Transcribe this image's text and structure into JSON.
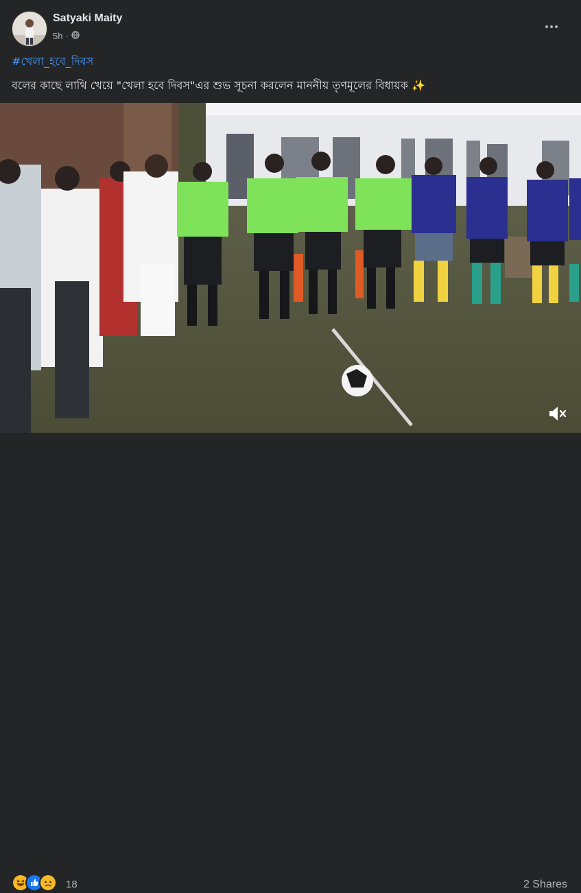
{
  "post": {
    "author": "Satyaki Maity",
    "time": "5h",
    "separator": "·",
    "audience_icon": "globe-icon",
    "hashtag": "#খেলা_হবে_দিবস",
    "caption": "বলের কাছে লাথি খেয়ে \"খেলা হবে দিবস\"এর শুভ সূচনা করলেন মাননীয় তৃণমূলের বিধায়ক",
    "caption_emoji": "✨"
  },
  "video": {
    "sound_icon": "speaker-muted-icon"
  },
  "footer": {
    "reaction_icons": [
      "haha-icon",
      "like-icon",
      "sad-icon"
    ],
    "reaction_count": "18",
    "shares": "2 Shares"
  },
  "colors": {
    "background": "#242526",
    "link": "#4599ff",
    "text_primary": "#e4e6eb",
    "text_secondary": "#b0b3b8",
    "referee_shirt": "#7fe35a",
    "player_shirt": "#2b2f8f"
  }
}
